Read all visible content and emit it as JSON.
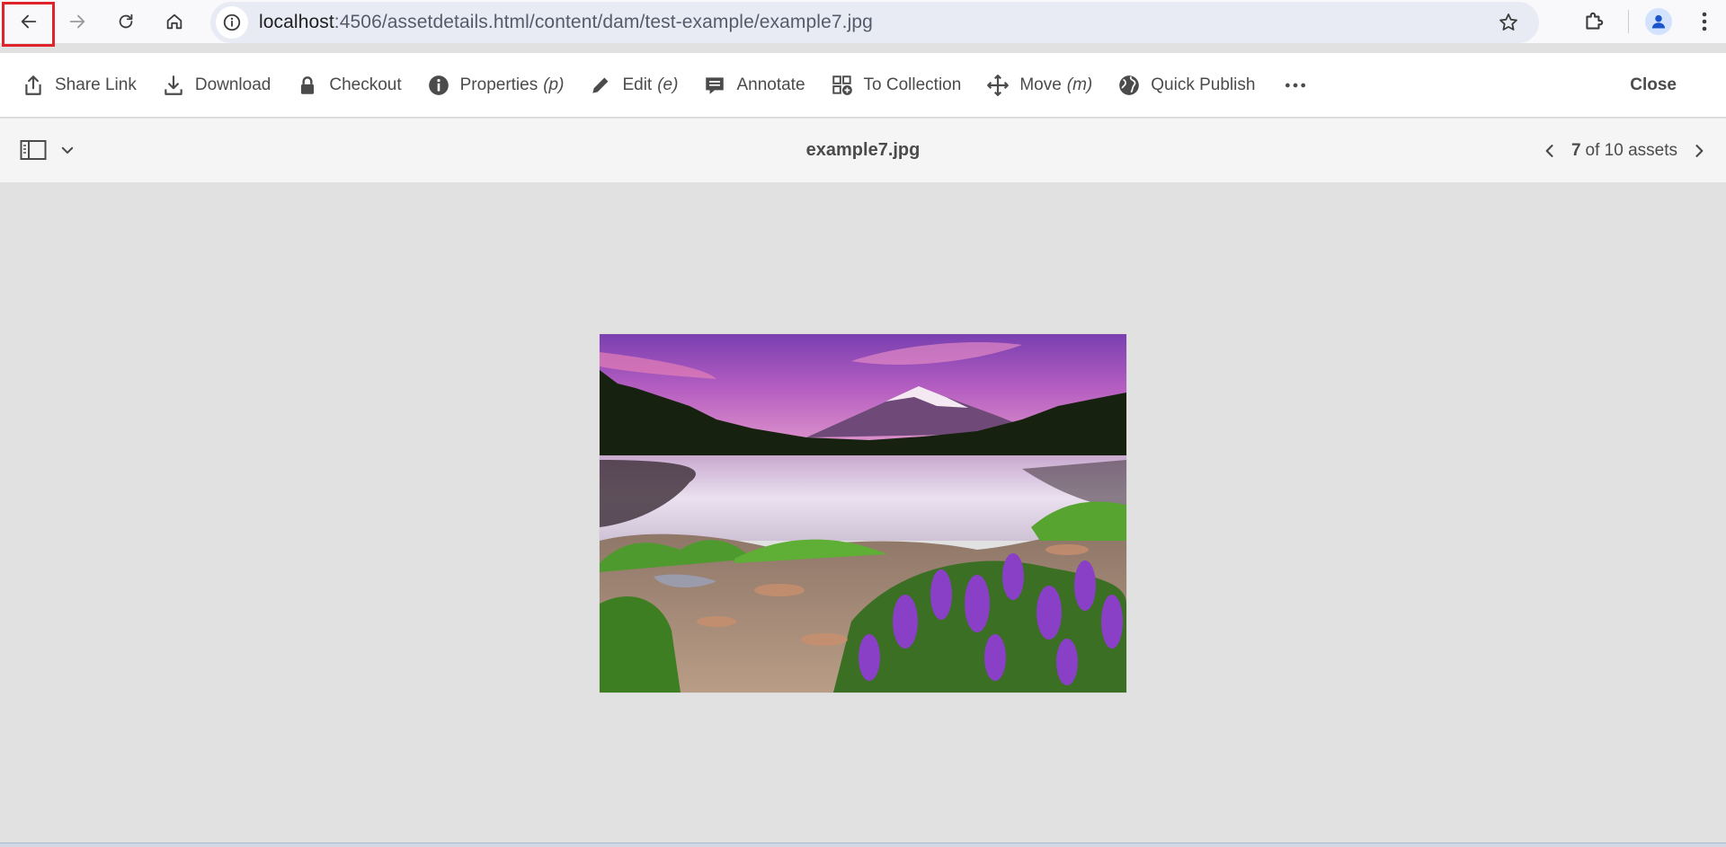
{
  "browser": {
    "url_host": "localhost",
    "url_path": ":4506/assetdetails.html/content/dam/test-example/example7.jpg"
  },
  "actions": [
    {
      "label": "Share Link",
      "shortcut": ""
    },
    {
      "label": "Download",
      "shortcut": ""
    },
    {
      "label": "Checkout",
      "shortcut": ""
    },
    {
      "label": "Properties",
      "shortcut": "(p)"
    },
    {
      "label": "Edit",
      "shortcut": "(e)"
    },
    {
      "label": "Annotate",
      "shortcut": ""
    },
    {
      "label": "To Collection",
      "shortcut": ""
    },
    {
      "label": "Move",
      "shortcut": "(m)"
    },
    {
      "label": "Quick Publish",
      "shortcut": ""
    }
  ],
  "close_label": "Close",
  "asset": {
    "title": "example7.jpg",
    "index": "7",
    "of_total": "of 10 assets"
  },
  "icons": {
    "back": "arrow-left-icon",
    "forward": "arrow-right-icon",
    "reload": "reload-icon",
    "home": "home-icon",
    "site_info": "info-icon",
    "bookmark": "star-icon",
    "extensions": "puzzle-icon",
    "profile": "person-icon",
    "menu": "kebab-icon"
  },
  "colors": {
    "highlight": "#e0242b",
    "canvas": "#e1e1e1",
    "action_text": "#4b4b4b"
  }
}
